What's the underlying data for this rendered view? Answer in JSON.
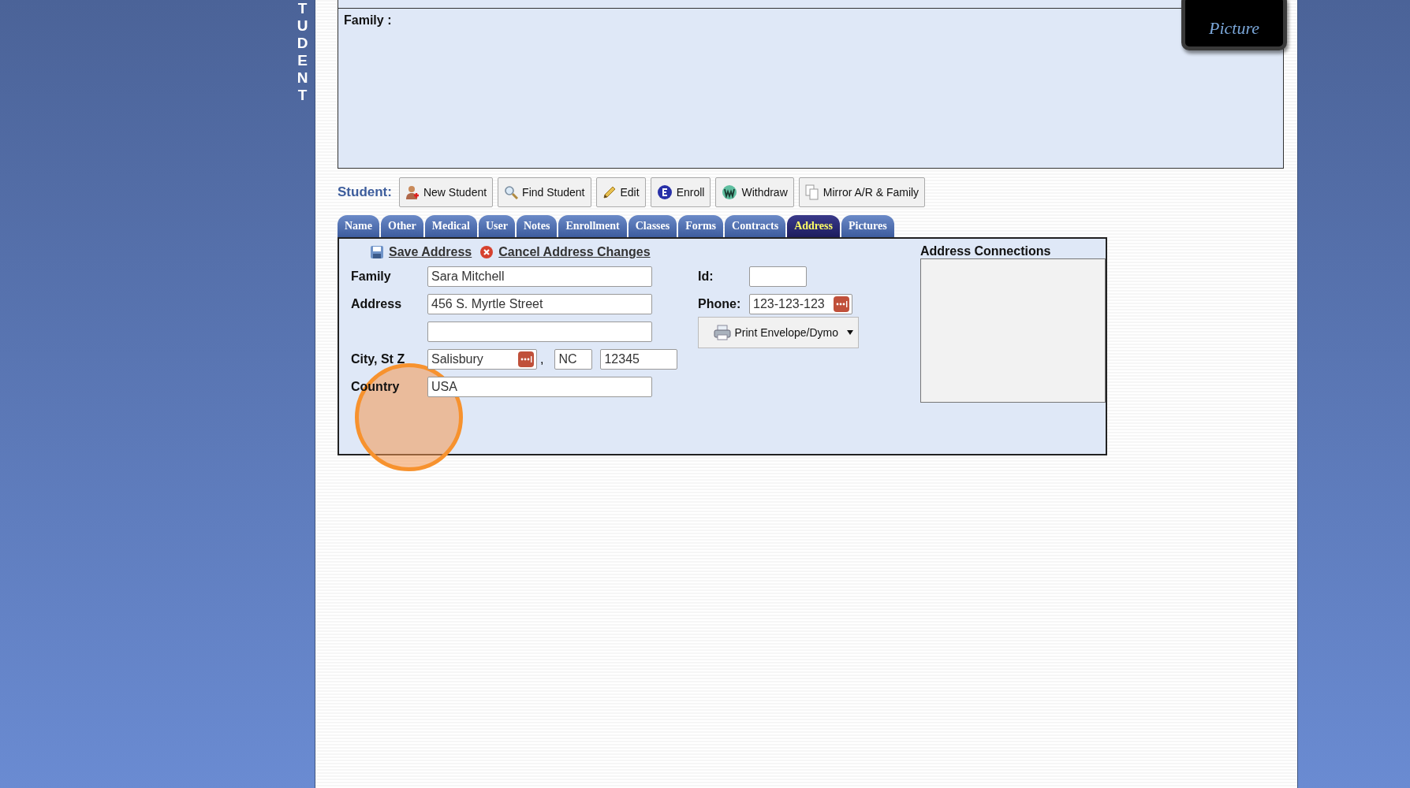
{
  "side_banner": {
    "letters": "TUDENT"
  },
  "family_panel": {
    "label": "Family :",
    "picture_badge": "Picture"
  },
  "toolbar": {
    "label": "Student:",
    "buttons": [
      {
        "label": "New Student"
      },
      {
        "label": "Find Student"
      },
      {
        "label": "Edit"
      },
      {
        "label": "Enroll"
      },
      {
        "label": "Withdraw"
      },
      {
        "label": "Mirror A/R & Family"
      }
    ]
  },
  "tabs": [
    {
      "label": "Name",
      "selected": false
    },
    {
      "label": "Other",
      "selected": false
    },
    {
      "label": "Medical",
      "selected": false
    },
    {
      "label": "User",
      "selected": false
    },
    {
      "label": "Notes",
      "selected": false
    },
    {
      "label": "Enrollment",
      "selected": false
    },
    {
      "label": "Classes",
      "selected": false
    },
    {
      "label": "Forms",
      "selected": false
    },
    {
      "label": "Contracts",
      "selected": false
    },
    {
      "label": "Address",
      "selected": true
    },
    {
      "label": "Pictures",
      "selected": false
    }
  ],
  "address_form": {
    "save_link": "Save Address",
    "cancel_link": "Cancel Address Changes",
    "family": {
      "label": "Family",
      "value": "Sara Mitchell"
    },
    "address": {
      "label": "Address",
      "value": "456 S. Myrtle Street"
    },
    "city_state_zip": {
      "label": "City, St Z",
      "city": "Salisbury",
      "separator": ",",
      "state": "NC",
      "zip": "12345"
    },
    "country": {
      "label": "Country",
      "value": "USA"
    },
    "id": {
      "label": "Id:"
    },
    "phone": {
      "label": "Phone:",
      "value": "123-123-123"
    },
    "print_button": "Print Envelope/Dymo"
  },
  "address_connections": {
    "title": "Address Connections"
  }
}
